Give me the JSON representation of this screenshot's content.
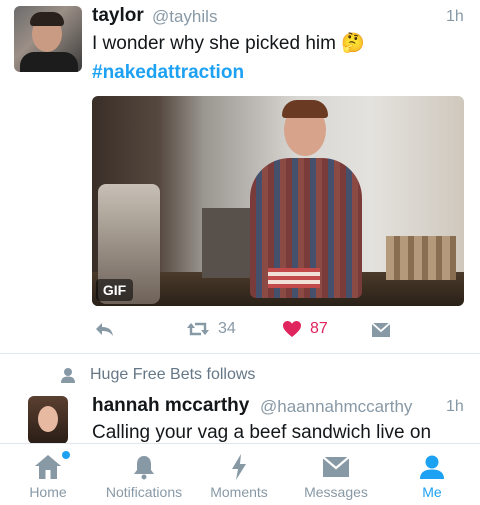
{
  "tweets": [
    {
      "name": "taylor",
      "handle": "@tayhils",
      "time": "1h",
      "text": "I wonder why she picked him 🤔",
      "hashtag": "#nakedattraction",
      "media_badge": "GIF",
      "retweets": "34",
      "likes": "87",
      "liked": true
    },
    {
      "social_context": "Huge Free Bets follows",
      "name": "hannah mccarthy",
      "handle": "@haannahmccarthy",
      "time": "1h",
      "text": "Calling your vag a beef sandwich live on"
    }
  ],
  "tabbar": {
    "items": [
      {
        "label": "Home",
        "icon": "home-icon",
        "has_notification_dot": true
      },
      {
        "label": "Notifications",
        "icon": "bell-icon"
      },
      {
        "label": "Moments",
        "icon": "lightning-icon"
      },
      {
        "label": "Messages",
        "icon": "envelope-icon"
      },
      {
        "label": "Me",
        "icon": "person-icon",
        "active": true
      }
    ]
  },
  "colors": {
    "accent": "#1da1f2",
    "like": "#e0245e",
    "muted": "#8899a6",
    "text": "#14171a"
  }
}
